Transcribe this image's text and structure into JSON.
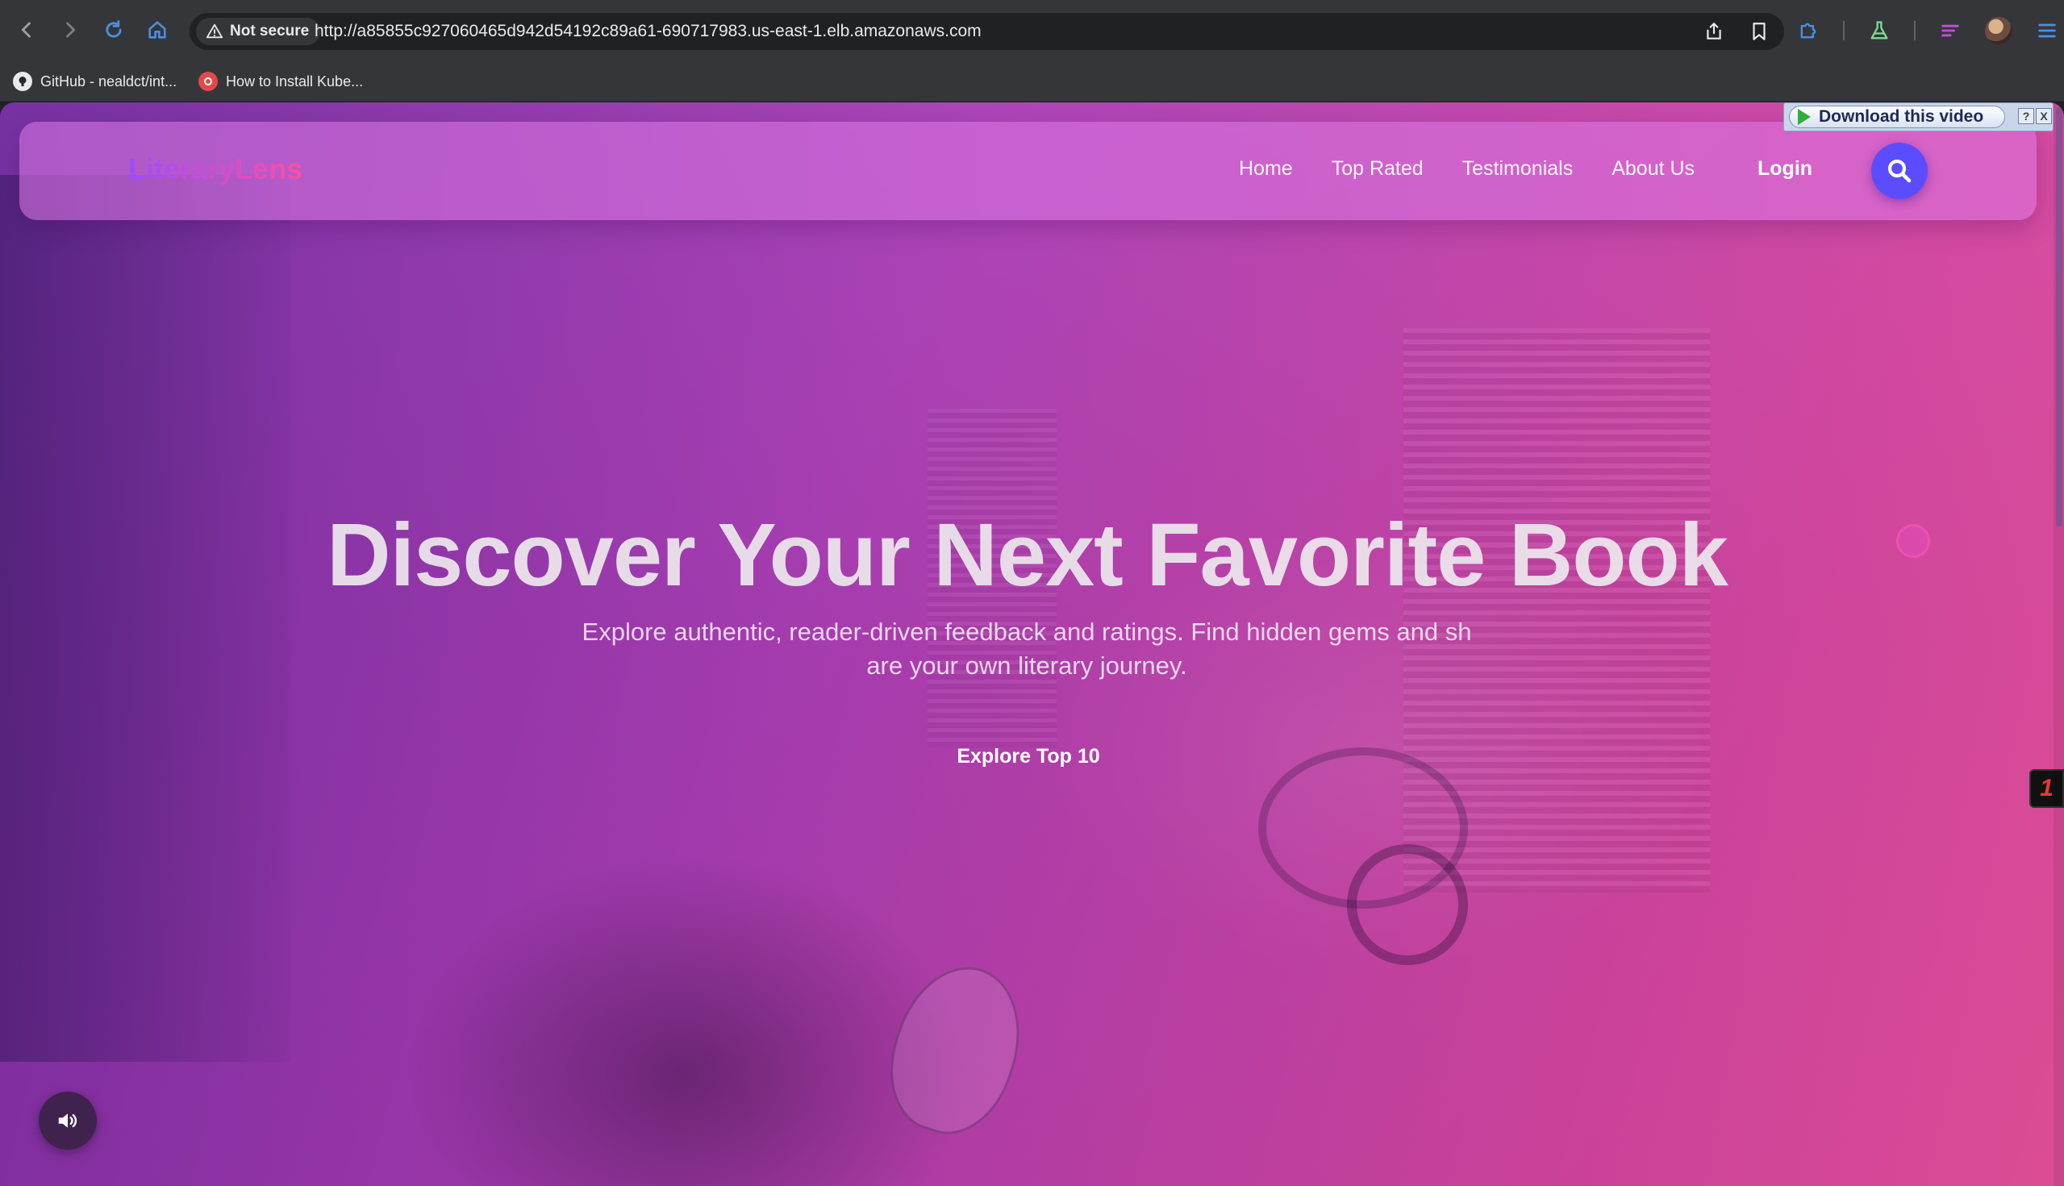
{
  "browser": {
    "security_label": "Not secure",
    "url": "http://a85855c927060465d942d54192c89a61-690717983.us-east-1.elb.amazonaws.com",
    "bookmarks": [
      {
        "label": "GitHub - nealdct/int...",
        "icon": "github-icon"
      },
      {
        "label": "How to Install Kube...",
        "icon": "kube-icon"
      }
    ]
  },
  "download_widget": {
    "label": "Download this video",
    "help": "?",
    "close": "X"
  },
  "site": {
    "logo": "LiteraryLens",
    "nav": [
      "Home",
      "Top Rated",
      "Testimonials",
      "About Us"
    ],
    "login": "Login",
    "accent_color": "#5b4dff"
  },
  "hero": {
    "title": "Discover Your Next Favorite Book",
    "subtitle": "Explore authentic, reader-driven feedback and ratings. Find hidden gems and sh are your own literary journey.",
    "cta": "Explore Top 10"
  },
  "side_widget": {
    "label": "1"
  }
}
